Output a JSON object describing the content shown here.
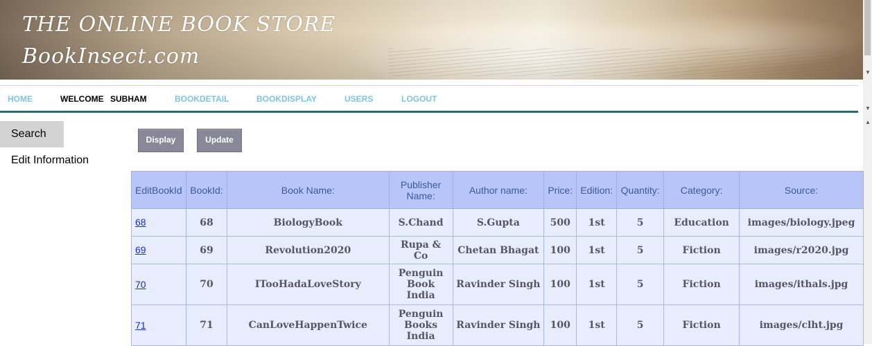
{
  "banner": {
    "line1": "THE ONLINE BOOK STORE",
    "line2": "BookInsect.com"
  },
  "nav": {
    "home": "HOME",
    "welcome_label": "WELCOME",
    "user": "SUBHAM",
    "bookdetail": "BOOKDETAIL",
    "bookdisplay": "BOOKDISPLAY",
    "users": "USERS",
    "logout": "LOGOUT"
  },
  "sidebar": {
    "search": "Search",
    "edit": "Edit Information"
  },
  "buttons": {
    "display": "Display",
    "update": "Update"
  },
  "table": {
    "headers": [
      "EditBookId",
      "BookId:",
      "Book Name:",
      "Publisher Name:",
      "Author name:",
      "Price:",
      "Edition:",
      "Quantity:",
      "Category:",
      "Source:"
    ],
    "rows": [
      {
        "edit": "68",
        "id": "68",
        "name": "BiologyBook",
        "publisher": "S.Chand",
        "author": "S.Gupta",
        "price": "500",
        "edition": "1st",
        "quantity": "5",
        "category": "Education",
        "source": "images/biology.jpeg"
      },
      {
        "edit": "69",
        "id": "69",
        "name": "Revolution2020",
        "publisher": "Rupa & Co",
        "author": "Chetan Bhagat",
        "price": "100",
        "edition": "1st",
        "quantity": "5",
        "category": "Fiction",
        "source": "images/r2020.jpg"
      },
      {
        "edit": "70",
        "id": "70",
        "name": "ITooHadaLoveStory",
        "publisher": "Penguin Book India",
        "author": "Ravinder Singh",
        "price": "100",
        "edition": "1st",
        "quantity": "5",
        "category": "Fiction",
        "source": "images/ithals.jpg"
      },
      {
        "edit": "71",
        "id": "71",
        "name": "CanLoveHappenTwice",
        "publisher": "Penguin Books India",
        "author": "Ravinder Singh",
        "price": "100",
        "edition": "1st",
        "quantity": "5",
        "category": "Fiction",
        "source": "images/clht.jpg"
      }
    ]
  }
}
